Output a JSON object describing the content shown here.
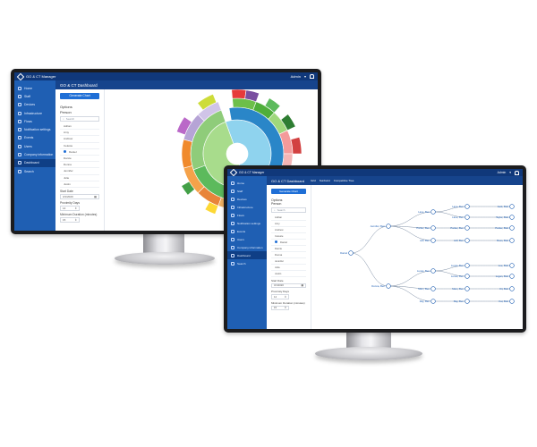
{
  "app": {
    "brand": "GO & CT Manager",
    "user": "Admin",
    "user_caret": "▾",
    "notifications_icon": "bell-icon",
    "accent": "#1f5fb3",
    "topbar_color": "#10387a"
  },
  "sidebar": {
    "items": [
      {
        "label": "Home",
        "icon": "home-icon"
      },
      {
        "label": "Staff",
        "icon": "person-icon"
      },
      {
        "label": "Devices",
        "icon": "device-icon"
      },
      {
        "label": "Infrastructure",
        "icon": "server-icon"
      },
      {
        "label": "Flows",
        "icon": "flow-icon"
      },
      {
        "label": "Notification settings",
        "icon": "bell-icon"
      },
      {
        "label": "Events",
        "icon": "calendar-icon"
      },
      {
        "label": "Users",
        "icon": "users-icon"
      },
      {
        "label": "Company information",
        "icon": "building-icon"
      },
      {
        "label": "Dashboard",
        "icon": "dashboard-icon",
        "active": true
      },
      {
        "label": "Search",
        "icon": "search-icon"
      }
    ]
  },
  "dashboard": {
    "title": "GO & CT Dashboard",
    "tabs": [
      "Grid",
      "Sunburst",
      "Competitive Tree"
    ],
    "generate_button": "Generate Chart",
    "options_heading": "Options",
    "person_heading": "Person",
    "search_placeholder": "Search",
    "person_options": [
      {
        "label": "Adrian"
      },
      {
        "label": "Amy"
      },
      {
        "label": "Andrew"
      },
      {
        "label": "Celeste"
      },
      {
        "label": "Daniel",
        "selected": true
      },
      {
        "label": "Darcie"
      },
      {
        "label": "Donna"
      },
      {
        "label": "Jennifer"
      },
      {
        "label": "Julie"
      },
      {
        "label": "Justin"
      }
    ],
    "start_date_label": "Start Date",
    "start_date_value": "3/1/2020",
    "proximity_label": "Proximity Days",
    "proximity_value": "14",
    "min_duration_label": "Minimum Duration (minutes)",
    "min_duration_value": "15"
  },
  "tree": {
    "root": "Daniel",
    "branches": [
      {
        "label": "Jennifer, Ben",
        "children": [
          {
            "label": "Lane, Ben",
            "children": [
              {
                "label": "Jack, Bob"
              },
              {
                "label": "Taylor, Bob"
              }
            ]
          },
          {
            "label": "Parker, Ben",
            "children": [
              {
                "label": "Parker, Bob"
              }
            ]
          },
          {
            "label": "Jeff, Ben",
            "children": [
              {
                "label": "Ross, Bob"
              }
            ]
          }
        ]
      },
      {
        "label": "Donna, Ben",
        "children": [
          {
            "label": "Lucas, Ben",
            "children": [
              {
                "label": "Lee, Bob"
              },
              {
                "label": "Logan, Bob"
              }
            ]
          },
          {
            "label": "Marc, Ben",
            "children": [
              {
                "label": "Kit, Bob"
              }
            ]
          },
          {
            "label": "Ray, Ben",
            "children": [
              {
                "label": "Kai, Bob"
              }
            ]
          }
        ]
      }
    ]
  }
}
